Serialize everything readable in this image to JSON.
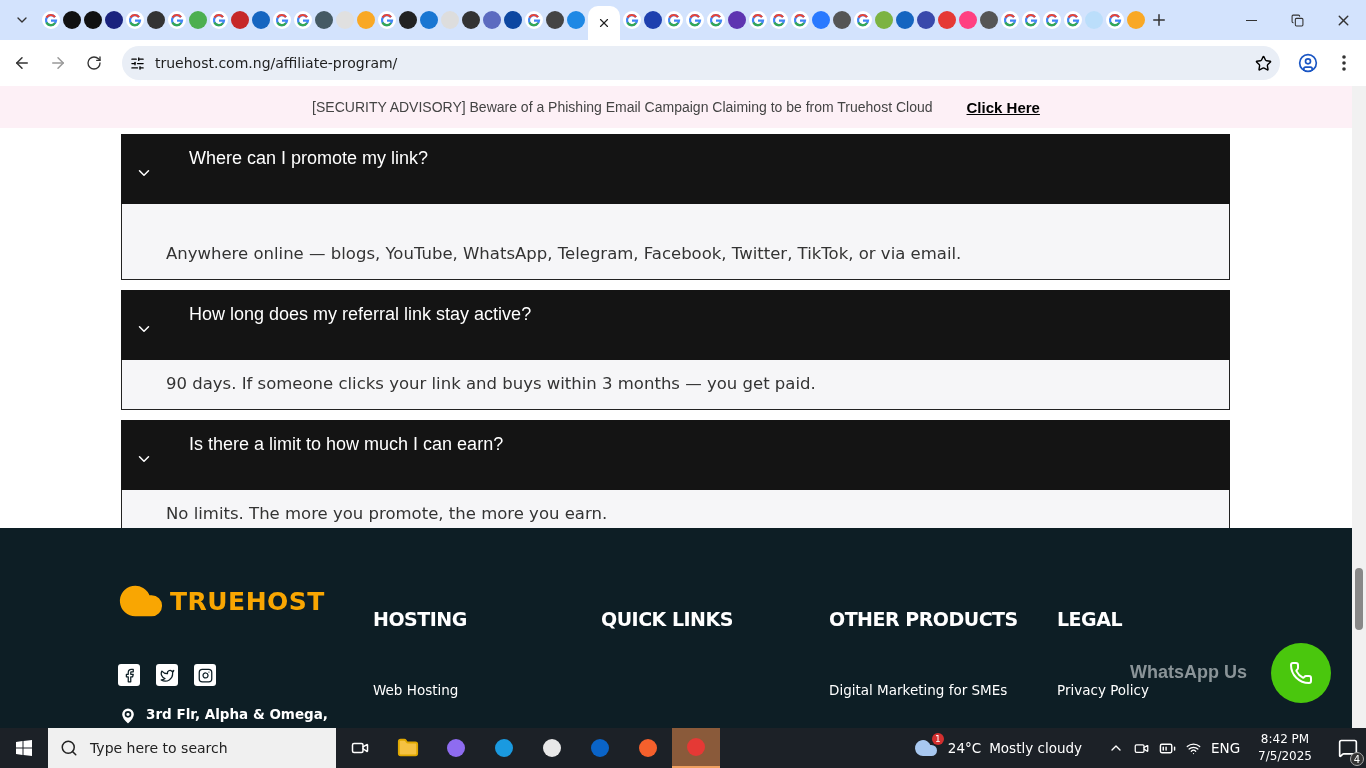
{
  "browser": {
    "tabs": [
      {
        "kind": "google",
        "selected": false
      },
      {
        "kind": "site",
        "color": "#111111",
        "selected": false
      },
      {
        "kind": "site",
        "color": "#111111",
        "selected": false
      },
      {
        "kind": "site",
        "color": "#1a237e",
        "selected": false
      },
      {
        "kind": "google",
        "selected": false
      },
      {
        "kind": "site",
        "color": "#333333",
        "selected": false
      },
      {
        "kind": "google",
        "selected": false
      },
      {
        "kind": "site",
        "color": "#4caf50",
        "selected": false
      },
      {
        "kind": "google",
        "selected": false
      },
      {
        "kind": "site",
        "color": "#c62828",
        "selected": false
      },
      {
        "kind": "site",
        "color": "#1565c0",
        "selected": false
      },
      {
        "kind": "google",
        "selected": false
      },
      {
        "kind": "google",
        "selected": false
      },
      {
        "kind": "site",
        "color": "#455a64",
        "selected": false
      },
      {
        "kind": "site",
        "color": "#e0e0e0",
        "selected": false
      },
      {
        "kind": "site",
        "color": "#f9a825",
        "selected": false
      },
      {
        "kind": "google",
        "selected": false
      },
      {
        "kind": "site",
        "color": "#222222",
        "selected": false
      },
      {
        "kind": "site",
        "color": "#1976d2",
        "selected": false
      },
      {
        "kind": "site",
        "color": "#dddddd",
        "selected": false
      },
      {
        "kind": "site",
        "color": "#333333",
        "selected": false
      },
      {
        "kind": "site",
        "color": "#5c6bc0",
        "selected": false
      },
      {
        "kind": "site",
        "color": "#0d47a1",
        "selected": false
      },
      {
        "kind": "google",
        "selected": false
      },
      {
        "kind": "site",
        "color": "#444444",
        "selected": false
      },
      {
        "kind": "site",
        "color": "#1e88e5",
        "selected": false
      },
      {
        "selected": true
      },
      {
        "kind": "google",
        "selected": false
      },
      {
        "kind": "site",
        "color": "#1e40af",
        "selected": false
      },
      {
        "kind": "google",
        "selected": false
      },
      {
        "kind": "google",
        "selected": false
      },
      {
        "kind": "google",
        "selected": false
      },
      {
        "kind": "site",
        "color": "#5e35b1",
        "selected": false
      },
      {
        "kind": "google",
        "selected": false
      },
      {
        "kind": "google",
        "selected": false
      },
      {
        "kind": "google",
        "selected": false
      },
      {
        "kind": "site",
        "color": "#2979ff",
        "selected": false
      },
      {
        "kind": "site",
        "color": "#555555",
        "selected": false
      },
      {
        "kind": "google",
        "selected": false
      },
      {
        "kind": "site",
        "color": "#7cb342",
        "selected": false
      },
      {
        "kind": "site",
        "color": "#1565c0",
        "selected": false
      },
      {
        "kind": "site",
        "color": "#3949ab",
        "selected": false
      },
      {
        "kind": "site",
        "color": "#e53935",
        "selected": false
      },
      {
        "kind": "site",
        "color": "#ff4081",
        "selected": false
      },
      {
        "kind": "site",
        "color": "#555555",
        "selected": false
      },
      {
        "kind": "google",
        "selected": false
      },
      {
        "kind": "google",
        "selected": false
      },
      {
        "kind": "google",
        "selected": false
      },
      {
        "kind": "google",
        "selected": false
      },
      {
        "kind": "site",
        "color": "#bbdefb",
        "selected": false
      },
      {
        "kind": "google",
        "selected": false
      },
      {
        "kind": "site",
        "color": "#f9a825",
        "selected": false
      }
    ],
    "address": "truehost.com.ng/affiliate-program/"
  },
  "advisory": {
    "message": "[SECURITY ADVISORY] Beware of a Phishing Email Campaign Claiming to be from Truehost Cloud",
    "link": "Click Here"
  },
  "faq": [
    {
      "question": "Where can I promote my link?",
      "answer": "Anywhere online — blogs, YouTube, WhatsApp, Telegram, Facebook, Twitter, TikTok, or via email.",
      "expanded": true
    },
    {
      "question": "How long does my referral link stay active?",
      "answer": "90 days. If someone clicks your link and buys within 3 months — you get paid.",
      "expanded": true
    },
    {
      "question": "Is there a limit to how much I can earn?",
      "answer": "No limits. The more you promote, the more you earn.",
      "expanded": true
    }
  ],
  "footer": {
    "brand": "TRUEHOST",
    "address": "3rd Flr, Alpha & Omega,",
    "columns": [
      {
        "heading": "HOSTING",
        "links": [
          "Web Hosting"
        ]
      },
      {
        "heading": "QUICK LINKS"
      },
      {
        "heading": "OTHER PRODUCTS",
        "links": [
          "Digital Marketing for SMEs"
        ]
      },
      {
        "heading": "LEGAL",
        "links": [
          "Privacy Policy"
        ]
      }
    ],
    "whatsapp_label": "WhatsApp Us"
  },
  "taskbar": {
    "search_placeholder": "Type here to search",
    "weather": {
      "badge": "1",
      "temperature": "24°C",
      "condition": "Mostly cloudy"
    },
    "language": "ENG",
    "time": "8:42 PM",
    "date": "7/5/2025",
    "notifications": "4"
  }
}
